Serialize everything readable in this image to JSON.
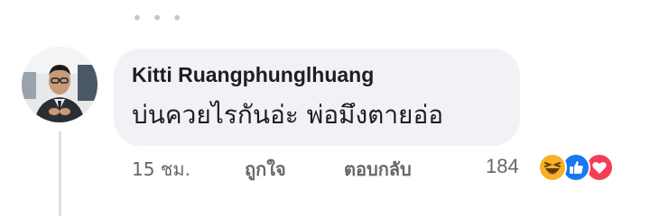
{
  "comment": {
    "author": "Kitti Ruangphunglhuang",
    "text": "บ่นควยไรกันอ่ะ พ่อมึงตายอ่อ",
    "time": "15 ชม.",
    "like_label": "ถูกใจ",
    "reply_label": "ตอบกลับ",
    "reaction_count": "184"
  },
  "icons": {
    "more": "more-dots-icon",
    "reactions": [
      "haha-reaction-icon",
      "like-reaction-icon",
      "love-reaction-icon"
    ]
  },
  "colors": {
    "bubble": "#f0f2f5",
    "secondary_text": "#65676b",
    "like_blue": "#1877f2",
    "love_red": "#f33e58",
    "haha_yellow": "#f7b125"
  }
}
